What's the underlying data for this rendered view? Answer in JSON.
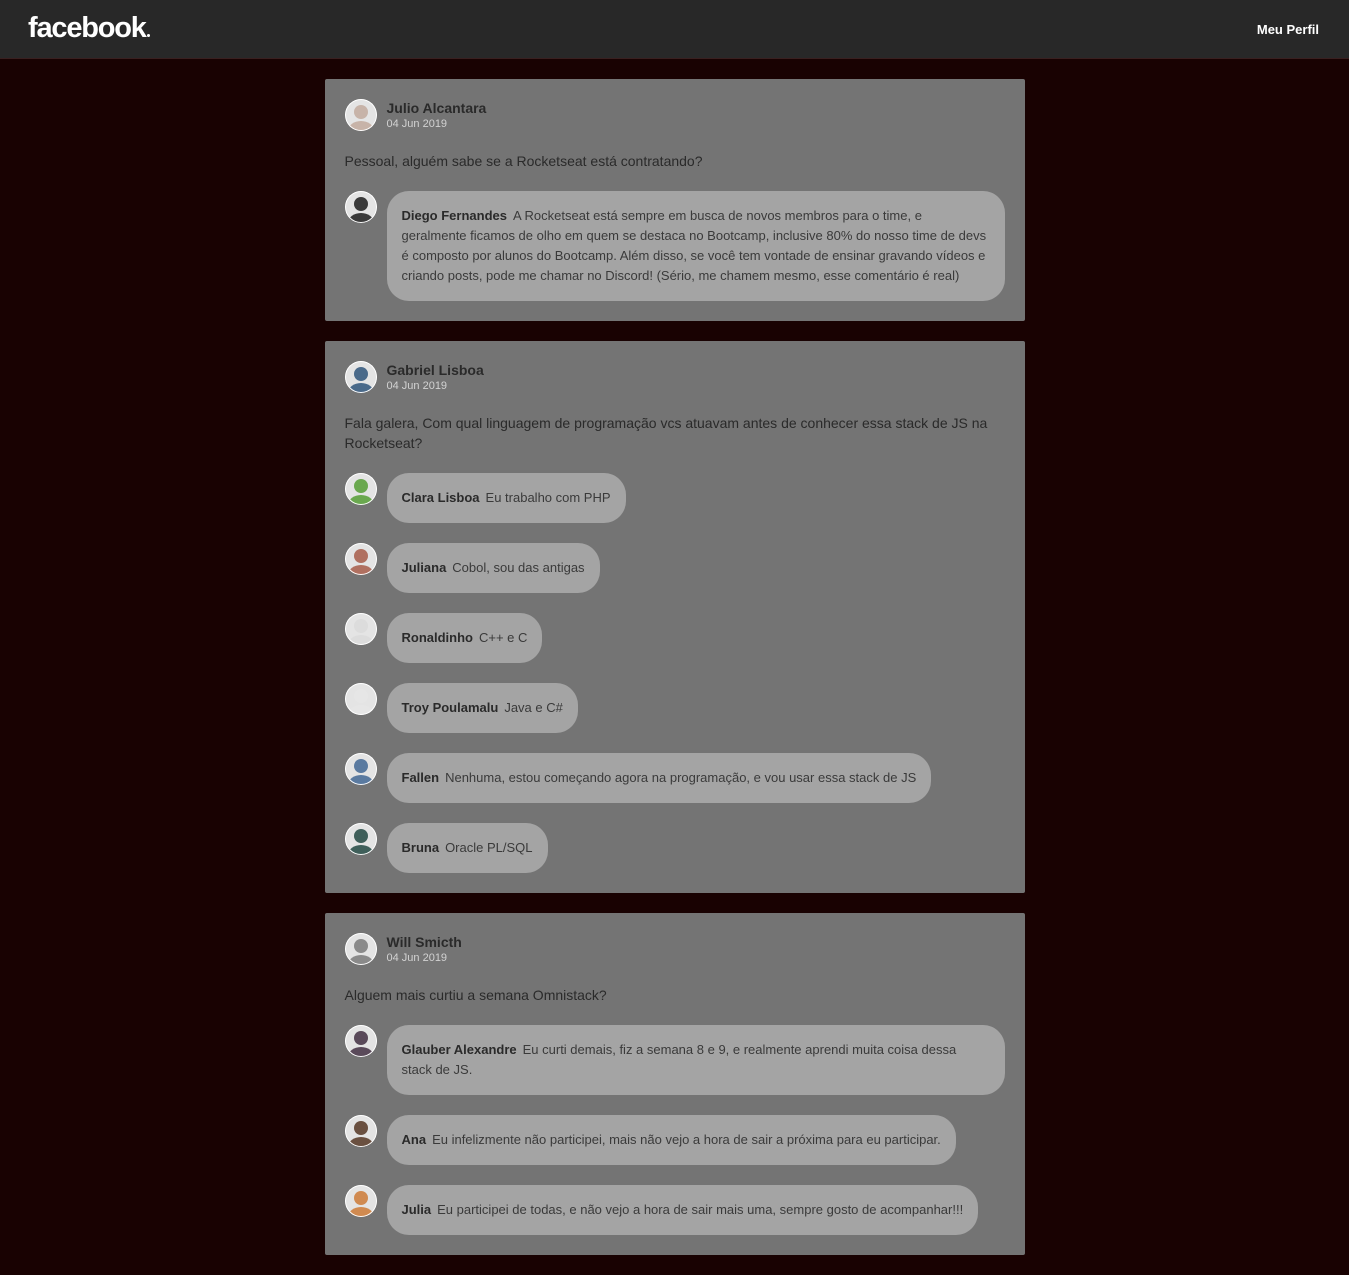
{
  "header": {
    "logo": "facebook",
    "profile_link": "Meu Perfil"
  },
  "posts": [
    {
      "author": "Julio Alcantara",
      "date": "04 Jun 2019",
      "content": "Pessoal, alguém sabe se a Rocketseat está contratando?",
      "avatar_color": "#c7b3a8",
      "comments": [
        {
          "author": "Diego Fernandes",
          "text": "A Rocketseat está sempre em busca de novos membros para o time, e geralmente ficamos de olho em quem se destaca no Bootcamp, inclusive 80% do nosso time de devs é composto por alunos do Bootcamp. Além disso, se você tem vontade de ensinar gravando vídeos e criando posts, pode me chamar no Discord! (Sério, me chamem mesmo, esse comentário é real)",
          "avatar_color": "#3a3a3a"
        }
      ]
    },
    {
      "author": "Gabriel Lisboa",
      "date": "04 Jun 2019",
      "content": "Fala galera, Com qual linguagem de programação vcs atuavam antes de conhecer essa stack de JS na Rocketseat?",
      "avatar_color": "#4a6a8a",
      "comments": [
        {
          "author": "Clara Lisboa",
          "text": "Eu trabalho com PHP",
          "avatar_color": "#6aa84f"
        },
        {
          "author": "Juliana",
          "text": "Cobol, sou das antigas",
          "avatar_color": "#b07060"
        },
        {
          "author": "Ronaldinho",
          "text": "C++ e C",
          "avatar_color": "#dcdcdc"
        },
        {
          "author": "Troy Poulamalu",
          "text": "Java e C#",
          "avatar_color": "#e6e6e6"
        },
        {
          "author": "Fallen",
          "text": "Nenhuma, estou começando agora na programação, e vou usar essa stack de JS",
          "avatar_color": "#5a7aa0"
        },
        {
          "author": "Bruna",
          "text": "Oracle PL/SQL",
          "avatar_color": "#3f5f5a"
        }
      ]
    },
    {
      "author": "Will Smicth",
      "date": "04 Jun 2019",
      "content": "Alguem mais curtiu a semana Omnistack?",
      "avatar_color": "#8a8a8a",
      "comments": [
        {
          "author": "Glauber Alexandre",
          "text": "Eu curti demais, fiz a semana 8 e 9, e realmente aprendi muita coisa dessa stack de JS.",
          "avatar_color": "#5a4a5a"
        },
        {
          "author": "Ana",
          "text": "Eu infelizmente não participei, mais não vejo a hora de sair a próxima para eu participar.",
          "avatar_color": "#6a5040"
        },
        {
          "author": "Julia",
          "text": "Eu participei de todas, e não vejo a hora de sair mais uma, sempre gosto de acompanhar!!!",
          "avatar_color": "#d08a50"
        }
      ]
    }
  ]
}
